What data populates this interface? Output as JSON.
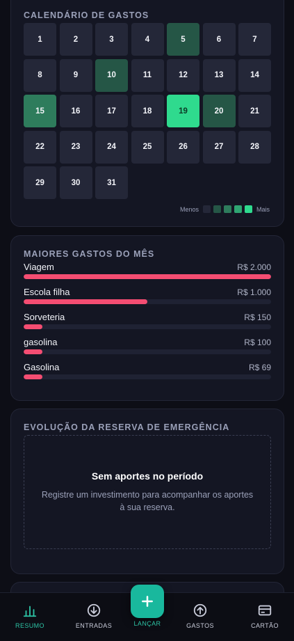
{
  "calendar": {
    "title": "CALENDÁRIO DE GASTOS",
    "days": [
      {
        "label": "1",
        "level": 0
      },
      {
        "label": "2",
        "level": 0
      },
      {
        "label": "3",
        "level": 0
      },
      {
        "label": "4",
        "level": 0
      },
      {
        "label": "5",
        "level": 2
      },
      {
        "label": "6",
        "level": 0
      },
      {
        "label": "7",
        "level": 0
      },
      {
        "label": "8",
        "level": 0
      },
      {
        "label": "9",
        "level": 0
      },
      {
        "label": "10",
        "level": 2
      },
      {
        "label": "11",
        "level": 0
      },
      {
        "label": "12",
        "level": 0
      },
      {
        "label": "13",
        "level": 0
      },
      {
        "label": "14",
        "level": 0
      },
      {
        "label": "15",
        "level": 3
      },
      {
        "label": "16",
        "level": 0
      },
      {
        "label": "17",
        "level": 0
      },
      {
        "label": "18",
        "level": 0
      },
      {
        "label": "19",
        "level": 4
      },
      {
        "label": "20",
        "level": 2
      },
      {
        "label": "21",
        "level": 0
      },
      {
        "label": "22",
        "level": 0
      },
      {
        "label": "23",
        "level": 0
      },
      {
        "label": "24",
        "level": 0
      },
      {
        "label": "25",
        "level": 0
      },
      {
        "label": "26",
        "level": 0
      },
      {
        "label": "27",
        "level": 0
      },
      {
        "label": "28",
        "level": 0
      },
      {
        "label": "29",
        "level": 0
      },
      {
        "label": "30",
        "level": 0
      },
      {
        "label": "31",
        "level": 0
      }
    ],
    "legend": {
      "less_label": "Menos",
      "more_label": "Mais",
      "colors": [
        "#242738",
        "#255646",
        "#2e7c5c",
        "#2fa572",
        "#2fda8e"
      ]
    }
  },
  "top_spending": {
    "title": "MAIORES GASTOS DO MÊS",
    "accent_color": "#f44d72",
    "items": [
      {
        "name": "Viagem",
        "value": "R$ 2.000",
        "fill_percent": 100
      },
      {
        "name": "Escola filha",
        "value": "R$ 1.000",
        "fill_percent": 50
      },
      {
        "name": "Sorveteria",
        "value": "R$ 150",
        "fill_percent": 7.5
      },
      {
        "name": "gasolina",
        "value": "R$ 100",
        "fill_percent": 5
      },
      {
        "name": "Gasolina",
        "value": "R$ 69",
        "fill_percent": 3.45
      }
    ]
  },
  "reserve": {
    "title": "EVOLUÇÃO DA RESERVA DE EMERGÊNCIA",
    "empty_title": "Sem aportes no período",
    "empty_description": "Registre um investimento para acompanhar os aportes à sua reserva."
  },
  "nav": {
    "items": [
      {
        "key": "resumo",
        "label": "RESUMO",
        "icon": "bar-chart-icon",
        "active": true
      },
      {
        "key": "entradas",
        "label": "ENTRADAS",
        "icon": "arrow-down-circle-icon",
        "active": false
      },
      {
        "key": "gastos",
        "label": "GASTOS",
        "icon": "arrow-up-circle-icon",
        "active": false
      },
      {
        "key": "cartao",
        "label": "CARTÃO",
        "icon": "credit-card-icon",
        "active": false
      }
    ],
    "fab_label": "LANÇAR",
    "fab_icon": "plus-icon",
    "active_color": "#2dc3a5"
  }
}
